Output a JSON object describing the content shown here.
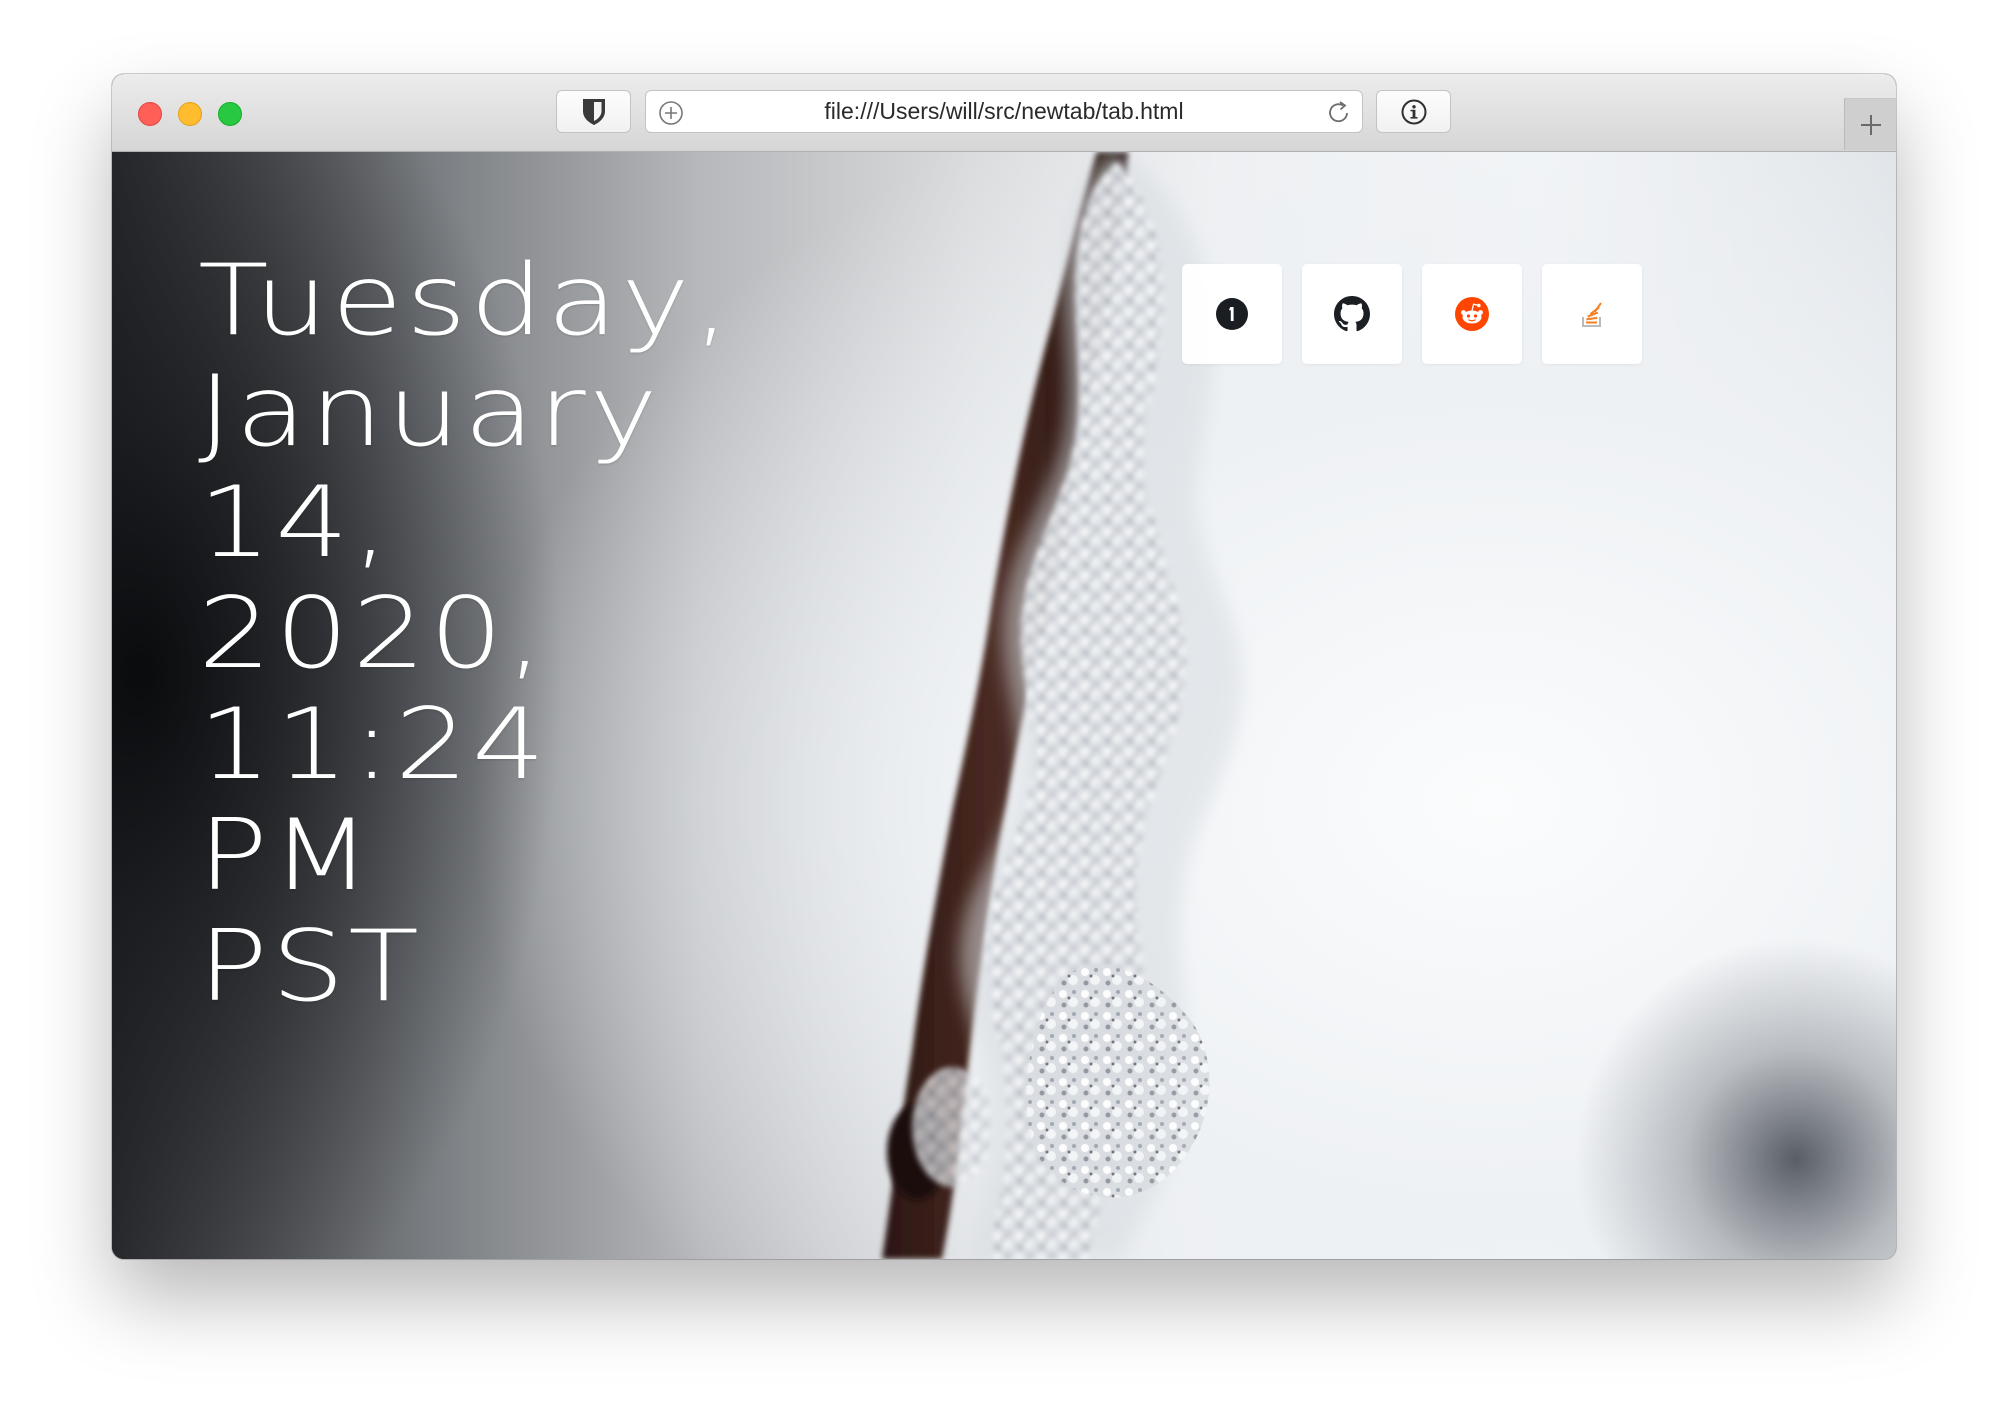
{
  "browser": {
    "url": "file:///Users/will/src/newtab/tab.html",
    "icons": {
      "close": "close-button",
      "minimize": "minimize-button",
      "maximize": "maximize-button",
      "shield": "shield-icon",
      "add": "add-icon",
      "reload": "reload-icon",
      "info": "info-icon",
      "new_tab": "plus-icon"
    }
  },
  "clock": {
    "lines": [
      "Tuesday,",
      "January",
      "14,",
      "2020,",
      "11:24",
      "PM",
      "PST"
    ]
  },
  "shortcuts": [
    {
      "icon": "1password-icon",
      "color": "#1a1d22"
    },
    {
      "icon": "github-icon",
      "color": "#1b1f23"
    },
    {
      "icon": "reddit-icon",
      "color": "#ff4500"
    },
    {
      "icon": "stack-overflow-icon",
      "color": "#f48024"
    }
  ],
  "colors": {
    "traffic_close": "#ff5f57",
    "traffic_minimize": "#febc2e",
    "traffic_maximize": "#28c840",
    "clock_text": "#ffffff"
  }
}
